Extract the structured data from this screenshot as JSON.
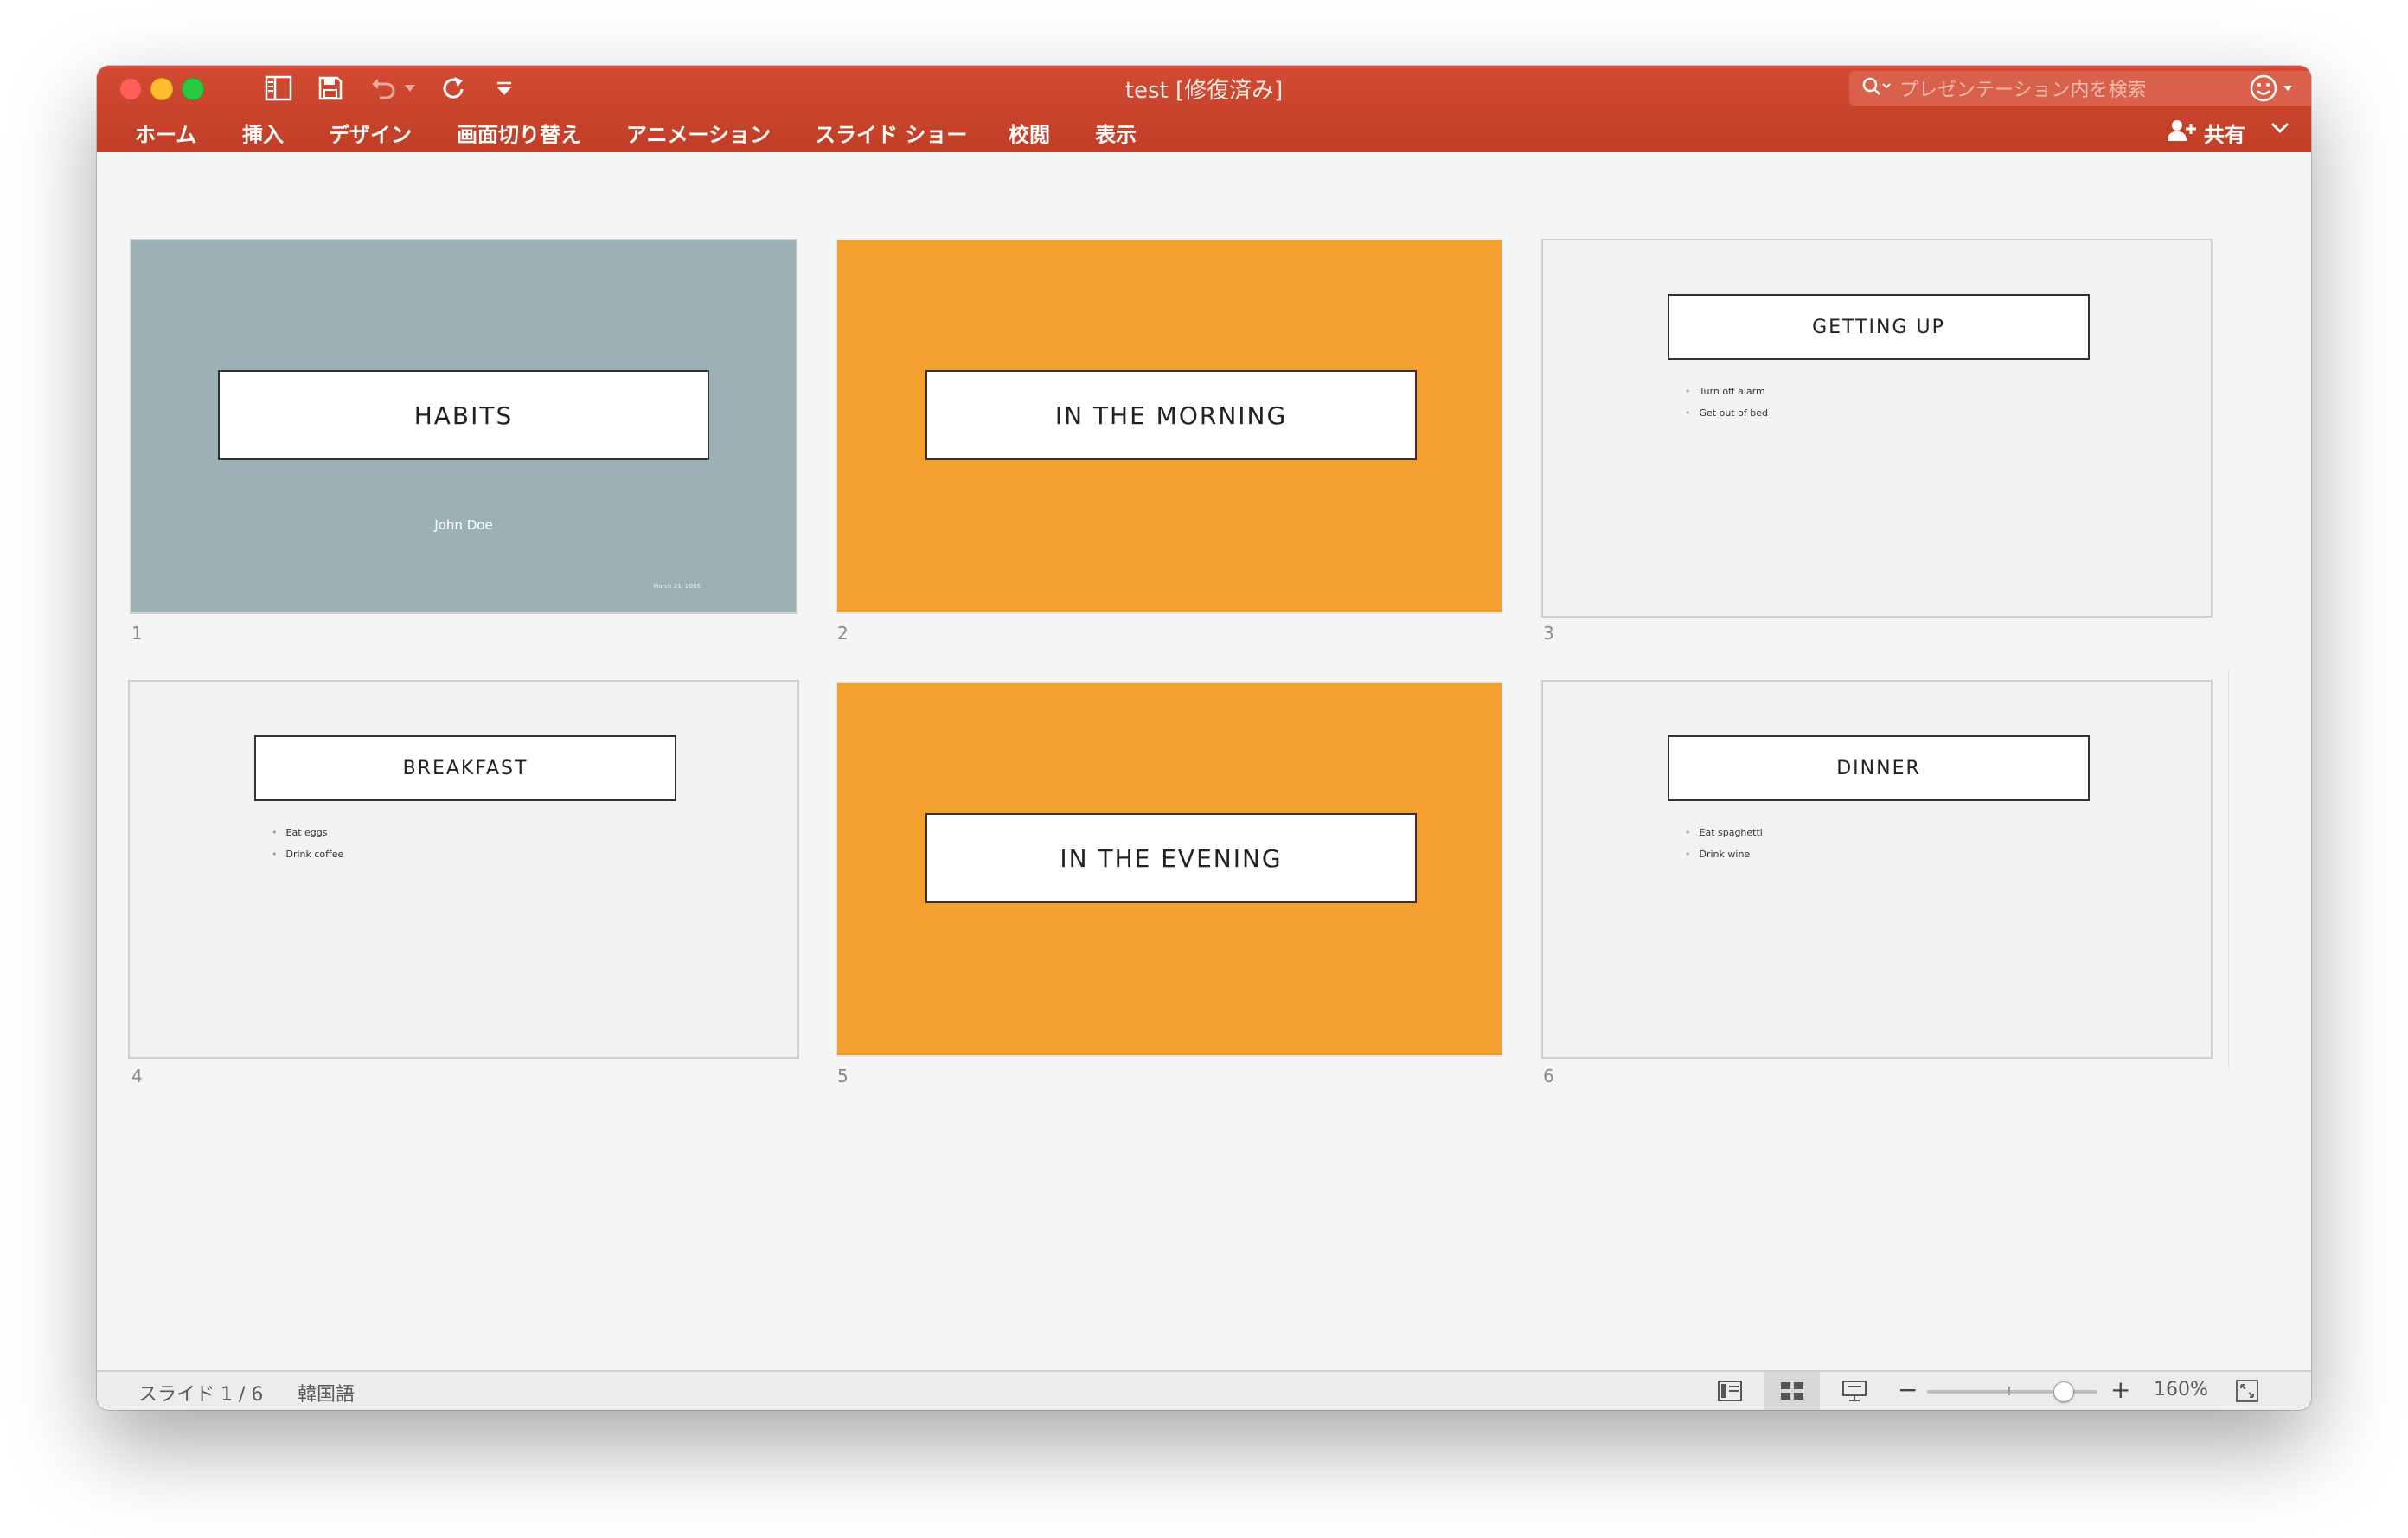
{
  "window": {
    "title": "test [修復済み]"
  },
  "search": {
    "placeholder": "プレゼンテーション内を検索"
  },
  "menu": {
    "items": [
      "ホーム",
      "挿入",
      "デザイン",
      "画面切り替え",
      "アニメーション",
      "スライド ショー",
      "校閲",
      "表示"
    ],
    "share_label": "共有"
  },
  "slides": [
    {
      "number": "1",
      "title": "HABITS",
      "subtitle": "John Doe",
      "date": "March 21, 2005",
      "bullets": []
    },
    {
      "number": "2",
      "title": "IN THE MORNING",
      "bullets": []
    },
    {
      "number": "3",
      "title": "GETTING UP",
      "bullets": [
        "Turn off alarm",
        "Get out of bed"
      ]
    },
    {
      "number": "4",
      "title": "BREAKFAST",
      "bullets": [
        "Eat eggs",
        "Drink coffee"
      ]
    },
    {
      "number": "5",
      "title": "IN THE EVENING",
      "bullets": []
    },
    {
      "number": "6",
      "title": "DINNER",
      "bullets": [
        "Eat spaghetti",
        "Drink wine"
      ]
    }
  ],
  "status": {
    "slide_indicator": "スライド 1 / 6",
    "language": "韓国語",
    "zoom": "160%",
    "zoom_minus": "−",
    "zoom_plus": "+"
  },
  "colors": {
    "ribbon": "#c7432b",
    "slide_gray": "#9db0b6",
    "slide_orange": "#f4a030",
    "slide_light": "#f2f2f2"
  },
  "icons": {
    "sidebar": "sidebar-toggle-icon",
    "save": "save-icon",
    "undo": "undo-icon",
    "redo": "redo-icon",
    "customize": "customize-toolbar-icon",
    "search": "search-icon",
    "feedback": "smiley-icon",
    "share": "add-person-icon",
    "collapse": "chevron-down-icon",
    "normal_view": "normal-view-icon",
    "sorter_view": "slide-sorter-icon",
    "presenter_view": "presenter-view-icon",
    "fit": "fit-to-window-icon"
  }
}
